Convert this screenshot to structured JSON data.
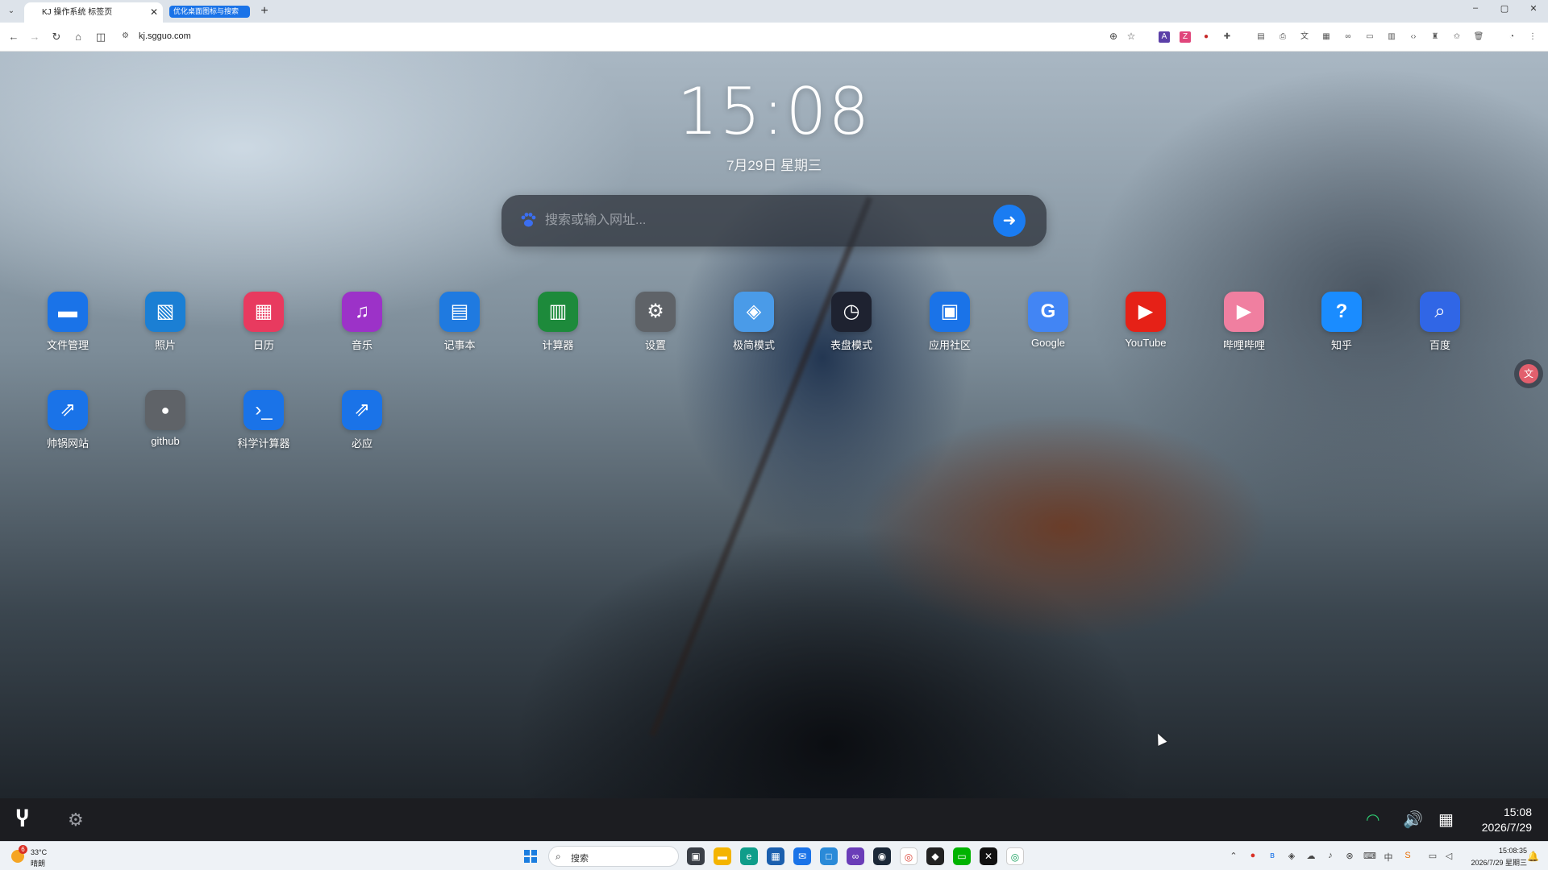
{
  "browser": {
    "tab_title": "KJ 操作系统 标签页",
    "tab_close": "✕",
    "tab_group_label": "优化桌面图标与搜索",
    "new_tab": "+",
    "url": "kj.sgguo.com",
    "window_controls": [
      "–",
      "▢",
      "✕"
    ]
  },
  "clock": {
    "time": "15:08",
    "date": "7月29日 星期三"
  },
  "search": {
    "placeholder": "搜索或输入网址...",
    "go_icon": "arrow-right-icon"
  },
  "apps": [
    {
      "label": "文件管理",
      "icon": "folder-icon",
      "color": "#1a73e8"
    },
    {
      "label": "照片",
      "icon": "photos-icon",
      "color": "#1b7fd4"
    },
    {
      "label": "日历",
      "icon": "calendar-icon",
      "color": "#e83a5f"
    },
    {
      "label": "音乐",
      "icon": "music-icon",
      "color": "#9c32c8"
    },
    {
      "label": "记事本",
      "icon": "notepad-icon",
      "color": "#1f7ae0"
    },
    {
      "label": "计算器",
      "icon": "calculator-icon",
      "color": "#1d8a3b"
    },
    {
      "label": "设置",
      "icon": "gear-icon",
      "color": "#5f6368"
    },
    {
      "label": "极简模式",
      "icon": "cube-icon",
      "color": "#4a9be8"
    },
    {
      "label": "表盘模式",
      "icon": "clock-icon",
      "color": "#1e2230"
    },
    {
      "label": "应用社区",
      "icon": "store-icon",
      "color": "#1a73e8"
    },
    {
      "label": "Google",
      "icon": "google-icon",
      "color": "#4285f4"
    },
    {
      "label": "YouTube",
      "icon": "youtube-icon",
      "color": "#e62117"
    },
    {
      "label": "哔哩哔哩",
      "icon": "bilibili-icon",
      "color": "#f07fa0"
    },
    {
      "label": "知乎",
      "icon": "zhihu-icon",
      "color": "#1a8cff"
    },
    {
      "label": "百度",
      "icon": "search-icon",
      "color": "#3066e6"
    },
    {
      "label": "帅锅网站",
      "icon": "external-link-icon",
      "color": "#1a73e8"
    },
    {
      "label": "github",
      "icon": "github-icon",
      "color": "#5f6368"
    },
    {
      "label": "科学计算器",
      "icon": "terminal-icon",
      "color": "#1a73e8"
    },
    {
      "label": "必应",
      "icon": "external-link-icon",
      "color": "#1a73e8"
    }
  ],
  "dock": {
    "time": "15:08",
    "date": "2026/7/29"
  },
  "taskbar": {
    "weather_temp": "33°C",
    "weather_cond": "晴朗",
    "weather_badge": "6",
    "search_label": "搜索",
    "time": "15:08:35",
    "date": "2026/7/29 星期三"
  }
}
